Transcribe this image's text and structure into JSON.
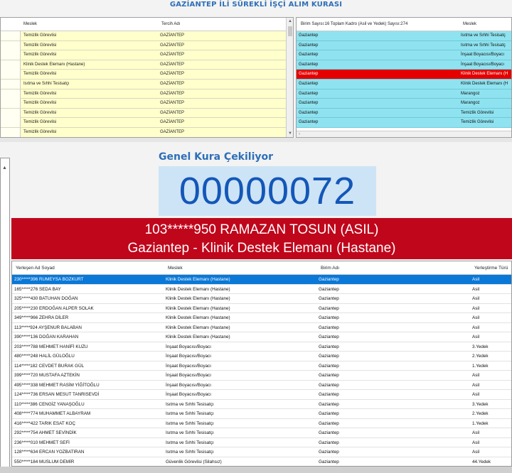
{
  "title": "GAZİANTEP İLİ SÜREKLİ İŞÇİ ALIM KURASI",
  "left_grid": {
    "headers": [
      "Meslek",
      "Tercih Adı"
    ],
    "rows": [
      {
        "meslek": "Temizlik Görevlisi",
        "tercih": "GAZİANTEP"
      },
      {
        "meslek": "Temizlik Görevlisi",
        "tercih": "GAZİANTEP"
      },
      {
        "meslek": "Temizlik Görevlisi",
        "tercih": "GAZİANTEP"
      },
      {
        "meslek": "Klinik Destek Elemanı (Hastane)",
        "tercih": "GAZİANTEP"
      },
      {
        "meslek": "Temizlik Görevlisi",
        "tercih": "GAZİANTEP"
      },
      {
        "meslek": "Isıtma ve Sıhhi Tesisatçı",
        "tercih": "GAZİANTEP"
      },
      {
        "meslek": "Temizlik Görevlisi",
        "tercih": "GAZİANTEP"
      },
      {
        "meslek": "Temizlik Görevlisi",
        "tercih": "GAZİANTEP"
      },
      {
        "meslek": "Temizlik Görevlisi",
        "tercih": "GAZİANTEP"
      },
      {
        "meslek": "Temizlik Görevlisi",
        "tercih": "GAZİANTEP"
      },
      {
        "meslek": "Temizlik Görevlisi",
        "tercih": "GAZİANTEP"
      }
    ]
  },
  "right_grid": {
    "headers": [
      "Birim Sayısı:16 Toplam Kadro (Asil ve Yedek) Sayısı:274",
      "Meslek"
    ],
    "rows": [
      {
        "birim": "Gaziantep",
        "meslek": "Isıtma ve Sıhhi Tesisatç"
      },
      {
        "birim": "Gaziantep",
        "meslek": "Isıtma ve Sıhhi Tesisatç"
      },
      {
        "birim": "Gaziantep",
        "meslek": "İnşaat Boyacısı/Boyacı"
      },
      {
        "birim": "Gaziantep",
        "meslek": "İnşaat Boyacısı/Boyacı"
      },
      {
        "birim": "Gaziantep",
        "meslek": "Klinik Destek Elemanı (H"
      },
      {
        "birim": "Gaziantep",
        "meslek": "Klinik Destek Elemanı (H"
      },
      {
        "birim": "Gaziantep",
        "meslek": "Marangoz"
      },
      {
        "birim": "Gaziantep",
        "meslek": "Marangoz"
      },
      {
        "birim": "Gaziantep",
        "meslek": "Temizlik Görevlisi"
      },
      {
        "birim": "Gaziantep",
        "meslek": "Temizlik Görevlisi"
      }
    ]
  },
  "draw_label": "Genel Kura Çekiliyor",
  "counter": "00000072",
  "winner": {
    "line1": "103*****950 RAMAZAN TOSUN (ASIL)",
    "line2": "Gaziantep - Klinik Destek Elemanı (Hastane)"
  },
  "bottom_grid": {
    "headers": [
      "Yerleşen Ad Soyad",
      "Meslek",
      "Birim Adı",
      "Yerleştirme Türü"
    ],
    "rows": [
      {
        "ad": "230*****396 RUMEYSA BOZKURT",
        "meslek": "Klinik Destek Elemanı (Hastane)",
        "birim": "Gaziantep",
        "tur": "Asil"
      },
      {
        "ad": "165*****276 SEDA BAY",
        "meslek": "Klinik Destek Elemanı (Hastane)",
        "birim": "Gaziantep",
        "tur": "Asil"
      },
      {
        "ad": "325*****430 BATUHAN DOĞAN",
        "meslek": "Klinik Destek Elemanı (Hastane)",
        "birim": "Gaziantep",
        "tur": "Asil"
      },
      {
        "ad": "205*****230 ERDOĞAN ALPER SOLAK",
        "meslek": "Klinik Destek Elemanı (Hastane)",
        "birim": "Gaziantep",
        "tur": "Asil"
      },
      {
        "ad": "349*****966 ZEHRA DİLER",
        "meslek": "Klinik Destek Elemanı (Hastane)",
        "birim": "Gaziantep",
        "tur": "Asil"
      },
      {
        "ad": "113*****924 AYŞENUR BALABAN",
        "meslek": "Klinik Destek Elemanı (Hastane)",
        "birim": "Gaziantep",
        "tur": "Asil"
      },
      {
        "ad": "390*****136 DOĞAN KARAHAN",
        "meslek": "Klinik Destek Elemanı (Hastane)",
        "birim": "Gaziantep",
        "tur": "Asil"
      },
      {
        "ad": "203*****788 MEHMET HANİFİ KUZU",
        "meslek": "İnşaat Boyacısı/Boyacı",
        "birim": "Gaziantep",
        "tur": "3.Yedek"
      },
      {
        "ad": "480*****248 HALİL GÜLOĞLU",
        "meslek": "İnşaat Boyacısı/Boyacı",
        "birim": "Gaziantep",
        "tur": "2.Yedek"
      },
      {
        "ad": "114*****182 CEVDET BURAK GÜL",
        "meslek": "İnşaat Boyacısı/Boyacı",
        "birim": "Gaziantep",
        "tur": "1.Yedek"
      },
      {
        "ad": "399*****720 MUSTAFA AZTEKİN",
        "meslek": "İnşaat Boyacısı/Boyacı",
        "birim": "Gaziantep",
        "tur": "Asil"
      },
      {
        "ad": "495*****338 MEHMET RASİM YİĞİTOĞLU",
        "meslek": "İnşaat Boyacısı/Boyacı",
        "birim": "Gaziantep",
        "tur": "Asil"
      },
      {
        "ad": "124*****736 ERSAN MESUT TANRISEVDİ",
        "meslek": "İnşaat Boyacısı/Boyacı",
        "birim": "Gaziantep",
        "tur": "Asil"
      },
      {
        "ad": "110*****386 CENGİZ YANAŞOĞLU",
        "meslek": "Isıtma ve Sıhhi Tesisatçı",
        "birim": "Gaziantep",
        "tur": "3.Yedek"
      },
      {
        "ad": "408*****774 MUHAMMET ALBAYRAM",
        "meslek": "Isıtma ve Sıhhi Tesisatçı",
        "birim": "Gaziantep",
        "tur": "2.Yedek"
      },
      {
        "ad": "416*****422 TARIK ESAT KOÇ",
        "meslek": "Isıtma ve Sıhhi Tesisatçı",
        "birim": "Gaziantep",
        "tur": "1.Yedek"
      },
      {
        "ad": "292*****754 AHMET SEVİNDİK",
        "meslek": "Isıtma ve Sıhhi Tesisatçı",
        "birim": "Gaziantep",
        "tur": "Asil"
      },
      {
        "ad": "236*****010 MEHMET SEFİ",
        "meslek": "Isıtma ve Sıhhi Tesisatçı",
        "birim": "Gaziantep",
        "tur": "Asil"
      },
      {
        "ad": "128*****634 ERCAN YOZBATIRAN",
        "meslek": "Isıtma ve Sıhhi Tesisatçı",
        "birim": "Gaziantep",
        "tur": "Asil"
      },
      {
        "ad": "550*****184 MUSLUM DEMİR",
        "meslek": "Güvenlik Görevlisi (Silahsız)",
        "birim": "Gaziantep",
        "tur": "44.Yedek"
      }
    ]
  },
  "colors": {
    "title_blue": "#2e6fb7",
    "left_row_bg": "#ffffcc",
    "right_row_bg": "#8fe3f0",
    "selected_red": "#e40000",
    "banner_red": "#c0061b",
    "selected_blue": "#0a78d7",
    "counter_bg": "#cde4f6",
    "counter_text": "#1457b8"
  }
}
